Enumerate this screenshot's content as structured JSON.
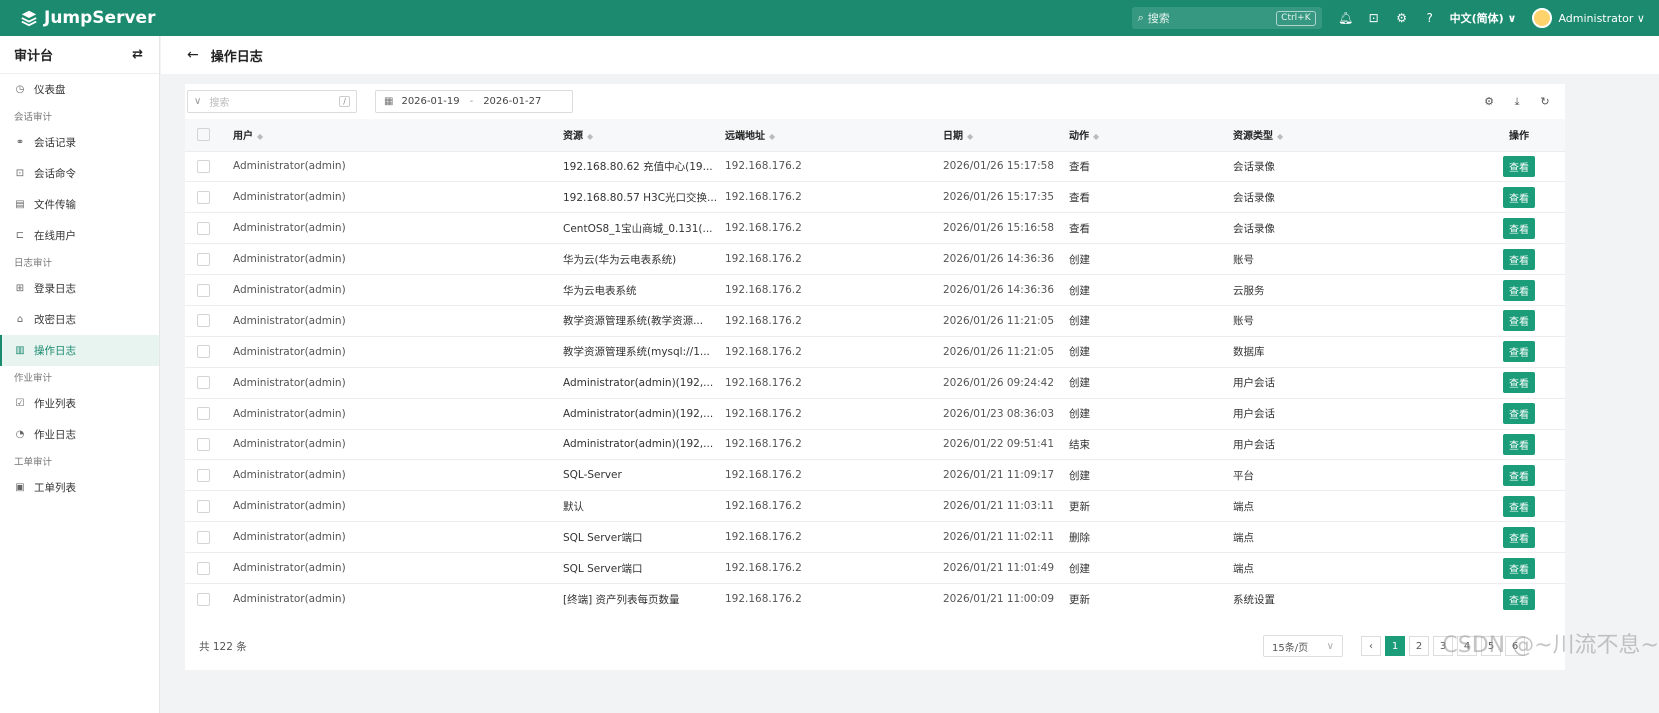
{
  "topbar": {
    "brand": "JumpServer",
    "search_placeholder": "搜索",
    "search_shortcut": "Ctrl+K",
    "language": "中文(简体) ∨",
    "user": "Administrator ∨",
    "icons": [
      "bell-icon",
      "terminal-icon",
      "settings-icon",
      "help-icon"
    ],
    "accent": "#1b8a6f"
  },
  "sidebar": {
    "title": "审计台",
    "switch_icon": "⇄",
    "items": [
      {
        "type": "item",
        "icon": "◷",
        "label": "仪表盘"
      },
      {
        "type": "group",
        "label": "会话审计"
      },
      {
        "type": "item",
        "icon": "⚭",
        "label": "会话记录"
      },
      {
        "type": "item",
        "icon": "⊡",
        "label": "会话命令"
      },
      {
        "type": "item",
        "icon": "▤",
        "label": "文件传输"
      },
      {
        "type": "item",
        "icon": "⊏",
        "label": "在线用户"
      },
      {
        "type": "group",
        "label": "日志审计"
      },
      {
        "type": "item",
        "icon": "⊞",
        "label": "登录日志"
      },
      {
        "type": "item",
        "icon": "⌂",
        "label": "改密日志"
      },
      {
        "type": "item",
        "icon": "▥",
        "label": "操作日志",
        "active": true
      },
      {
        "type": "group",
        "label": "作业审计"
      },
      {
        "type": "item",
        "icon": "☑",
        "label": "作业列表"
      },
      {
        "type": "item",
        "icon": "◔",
        "label": "作业日志"
      },
      {
        "type": "group",
        "label": "工单审计"
      },
      {
        "type": "item",
        "icon": "▣",
        "label": "工单列表"
      }
    ]
  },
  "page": {
    "back": "←",
    "title": "操作日志"
  },
  "toolbar": {
    "filter_placeholder": "搜索",
    "filter_shortcut": "/",
    "date_from": "2026-01-19",
    "date_sep": "-",
    "date_to": "2026-01-27"
  },
  "table": {
    "headers": [
      "用户",
      "资源",
      "远端地址",
      "日期",
      "动作",
      "资源类型",
      "操作"
    ],
    "rows": [
      {
        "user": "Administrator(admin)",
        "resource": "192.168.80.62 充值中心(19...",
        "addr": "192.168.176.2",
        "date": "2026/01/26 15:17:58",
        "action": "查看",
        "type": "会话录像",
        "op": "查看"
      },
      {
        "user": "Administrator(admin)",
        "resource": "192.168.80.57 H3C光口交换...",
        "addr": "192.168.176.2",
        "date": "2026/01/26 15:17:35",
        "action": "查看",
        "type": "会话录像",
        "op": "查看"
      },
      {
        "user": "Administrator(admin)",
        "resource": "CentOS8_1宝山商城_0.131(...",
        "addr": "192.168.176.2",
        "date": "2026/01/26 15:16:58",
        "action": "查看",
        "type": "会话录像",
        "op": "查看"
      },
      {
        "user": "Administrator(admin)",
        "resource": "华为云(华为云电表系统)",
        "addr": "192.168.176.2",
        "date": "2026/01/26 14:36:36",
        "action": "创建",
        "type": "账号",
        "op": "查看"
      },
      {
        "user": "Administrator(admin)",
        "resource": "华为云电表系统",
        "addr": "192.168.176.2",
        "date": "2026/01/26 14:36:36",
        "action": "创建",
        "type": "云服务",
        "op": "查看"
      },
      {
        "user": "Administrator(admin)",
        "resource": "教学资源管理系统(教学资源...",
        "addr": "192.168.176.2",
        "date": "2026/01/26 11:21:05",
        "action": "创建",
        "type": "账号",
        "op": "查看"
      },
      {
        "user": "Administrator(admin)",
        "resource": "教学资源管理系统(mysql://1...",
        "addr": "192.168.176.2",
        "date": "2026/01/26 11:21:05",
        "action": "创建",
        "type": "数据库",
        "op": "查看"
      },
      {
        "user": "Administrator(admin)",
        "resource": "Administrator(admin)(192,...",
        "addr": "192.168.176.2",
        "date": "2026/01/26 09:24:42",
        "action": "创建",
        "type": "用户会话",
        "op": "查看"
      },
      {
        "user": "Administrator(admin)",
        "resource": "Administrator(admin)(192,...",
        "addr": "192.168.176.2",
        "date": "2026/01/23 08:36:03",
        "action": "创建",
        "type": "用户会话",
        "op": "查看"
      },
      {
        "user": "Administrator(admin)",
        "resource": "Administrator(admin)(192,...",
        "addr": "192.168.176.2",
        "date": "2026/01/22 09:51:41",
        "action": "结束",
        "type": "用户会话",
        "op": "查看"
      },
      {
        "user": "Administrator(admin)",
        "resource": "SQL-Server",
        "addr": "192.168.176.2",
        "date": "2026/01/21 11:09:17",
        "action": "创建",
        "type": "平台",
        "op": "查看"
      },
      {
        "user": "Administrator(admin)",
        "resource": "默认",
        "addr": "192.168.176.2",
        "date": "2026/01/21 11:03:11",
        "action": "更新",
        "type": "端点",
        "op": "查看"
      },
      {
        "user": "Administrator(admin)",
        "resource": "SQL Server端口",
        "addr": "192.168.176.2",
        "date": "2026/01/21 11:02:11",
        "action": "删除",
        "type": "端点",
        "op": "查看"
      },
      {
        "user": "Administrator(admin)",
        "resource": "SQL Server端口",
        "addr": "192.168.176.2",
        "date": "2026/01/21 11:01:49",
        "action": "创建",
        "type": "端点",
        "op": "查看"
      },
      {
        "user": "Administrator(admin)",
        "resource": "[终端] 资产列表每页数量",
        "addr": "192.168.176.2",
        "date": "2026/01/21 11:00:09",
        "action": "更新",
        "type": "系统设置",
        "op": "查看"
      }
    ]
  },
  "footer": {
    "total": "共 122 条",
    "page_size": "15条/页",
    "pages": [
      "1",
      "2",
      "3",
      "4",
      "5",
      "6"
    ],
    "current_page": "1"
  },
  "watermark": "CSDN @~川流不息~"
}
